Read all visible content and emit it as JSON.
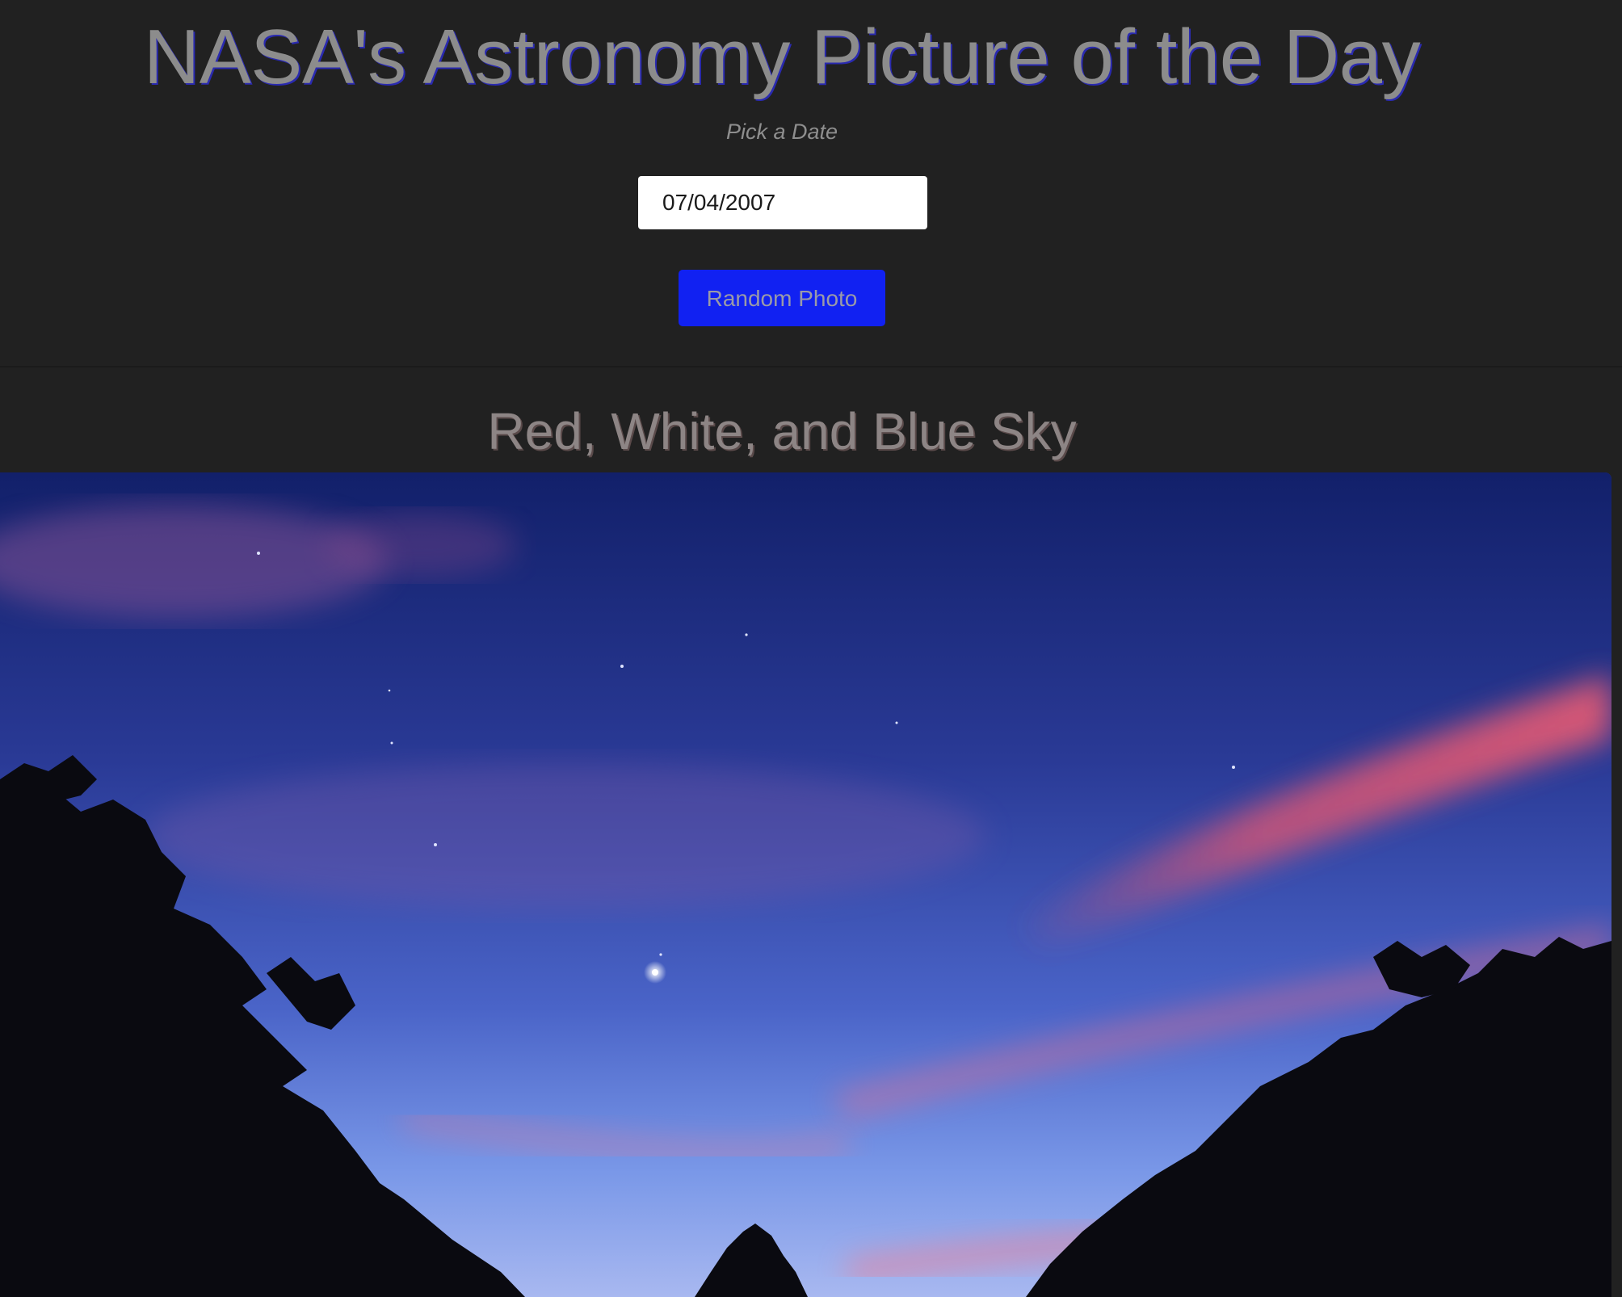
{
  "header": {
    "title": "NASA's Astronomy Picture of the Day",
    "subtitle": "Pick a Date",
    "date_value": "07/04/2007",
    "random_button_label": "Random Photo"
  },
  "photo": {
    "title": "Red, White, and Blue Sky"
  },
  "colors": {
    "background": "#212121",
    "button": "#1121f2",
    "title_text": "#8c8c8c",
    "title_shadow": "#2a2ab0"
  }
}
